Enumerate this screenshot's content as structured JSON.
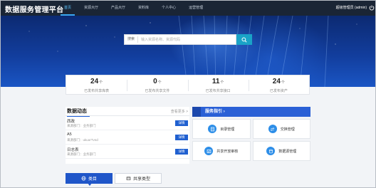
{
  "app": {
    "title": "数据服务管理平台"
  },
  "nav": {
    "items": [
      {
        "label": "首页",
        "active": true
      },
      {
        "label": "资源大厅",
        "active": false
      },
      {
        "label": "产品大厅",
        "active": false
      },
      {
        "label": "资料库",
        "active": false
      },
      {
        "label": "个人中心",
        "active": false
      },
      {
        "label": "运营管理",
        "active": false
      }
    ],
    "user": "超级管理员 (admin)"
  },
  "search": {
    "type_label": "搜索",
    "placeholder": "输入资源名称、资源代码"
  },
  "stats": [
    {
      "value": "24",
      "unit": "个",
      "label": "已发布共享库表"
    },
    {
      "value": "0",
      "unit": "个",
      "label": "已发布共享文件"
    },
    {
      "value": "11",
      "unit": "个",
      "label": "已发布共享接口"
    },
    {
      "value": "24",
      "unit": "个",
      "label": "已发布资产"
    }
  ],
  "news": {
    "title": "数据动态",
    "more": "查看更多 >",
    "items": [
      {
        "name": "西政",
        "sub": "来源部门：业务部门",
        "action": "详情"
      },
      {
        "name": "A5",
        "sub": "来源部门：ukuorTvnd",
        "action": "详情"
      },
      {
        "name": "日志表",
        "sub": "来源部门：业务部门",
        "action": "详情"
      }
    ]
  },
  "guide": {
    "title": "服务指引",
    "tiles": [
      {
        "label": "目录管理",
        "icon": "catalog-icon"
      },
      {
        "label": "交换管理",
        "icon": "exchange-icon"
      },
      {
        "label": "共享开放审核",
        "icon": "review-icon"
      },
      {
        "label": "数据源管理",
        "icon": "datasource-icon"
      }
    ]
  },
  "tabs": [
    {
      "label": "类目",
      "icon": "globe-icon",
      "active": true
    },
    {
      "label": "共享类型",
      "icon": "share-type-icon",
      "active": false
    }
  ],
  "colors": {
    "nav_bg": "#1a2535",
    "accent": "#2060d0",
    "search_button": "#1aa3c7",
    "banner": "#123d9c"
  }
}
